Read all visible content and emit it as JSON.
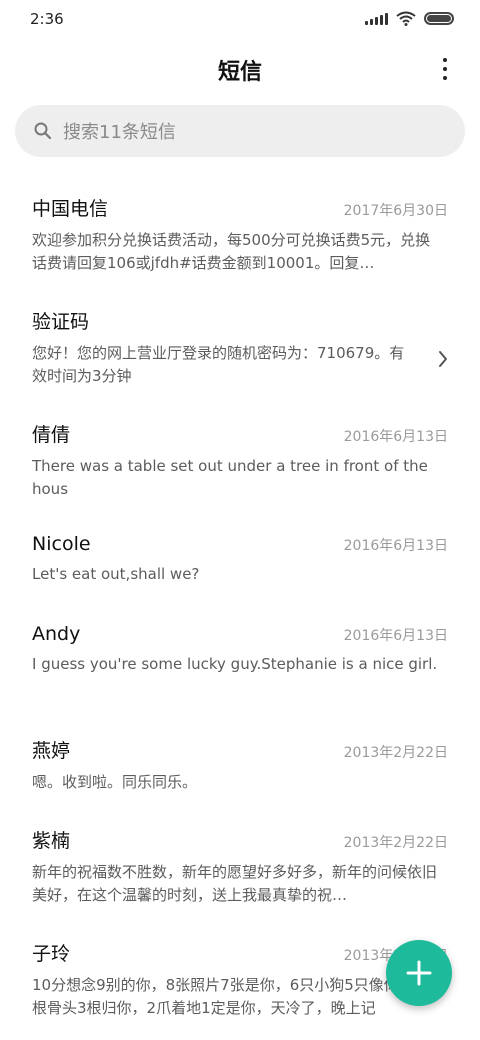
{
  "status": {
    "time": "2:36"
  },
  "header": {
    "title": "短信"
  },
  "search": {
    "placeholder": "搜索11条短信"
  },
  "threads": [
    {
      "name": "中国电信",
      "date": "2017年6月30日",
      "snippet": "欢迎参加积分兑换话费活动，每500分可兑换话费5元，兑换话费请回复106或jfdh#话费金额到10001。回复…"
    },
    {
      "name": "验证码",
      "date": "",
      "snippet": "您好！您的网上营业厅登录的随机密码为：710679。有效时间为3分钟"
    },
    {
      "name": "倩倩",
      "date": "2016年6月13日",
      "snippet": "There was a table set out under a tree in front of the hous"
    },
    {
      "name": "Nicole",
      "date": "2016年6月13日",
      "snippet": "Let's eat out,shall we?"
    },
    {
      "name": "Andy",
      "date": "2016年6月13日",
      "snippet": "I guess you're some lucky guy.Stephanie is a nice girl."
    },
    {
      "name": "燕婷",
      "date": "2013年2月22日",
      "snippet": "嗯。收到啦。同乐同乐。"
    },
    {
      "name": "紫楠",
      "date": "2013年2月22日",
      "snippet": "新年的祝福数不胜数，新年的愿望好多好多，新年的问候依旧美好，在这个温馨的时刻，送上我最真挚的祝…"
    },
    {
      "name": "子玲",
      "date": "2013年2月22日",
      "snippet": "10分想念9别的你，8张照片7张是你，6只小狗5只像你，4根骨头3根归你，2爪着地1定是你，天冷了，晚上记"
    }
  ],
  "colors": {
    "fab": "#1dba9b",
    "date": "#9a9a9a",
    "snippet": "#5c5c5c"
  },
  "icons": {
    "search": "search-icon",
    "more": "more-vertical-icon",
    "compose": "plus-icon",
    "chevron": "chevron-right-icon"
  }
}
